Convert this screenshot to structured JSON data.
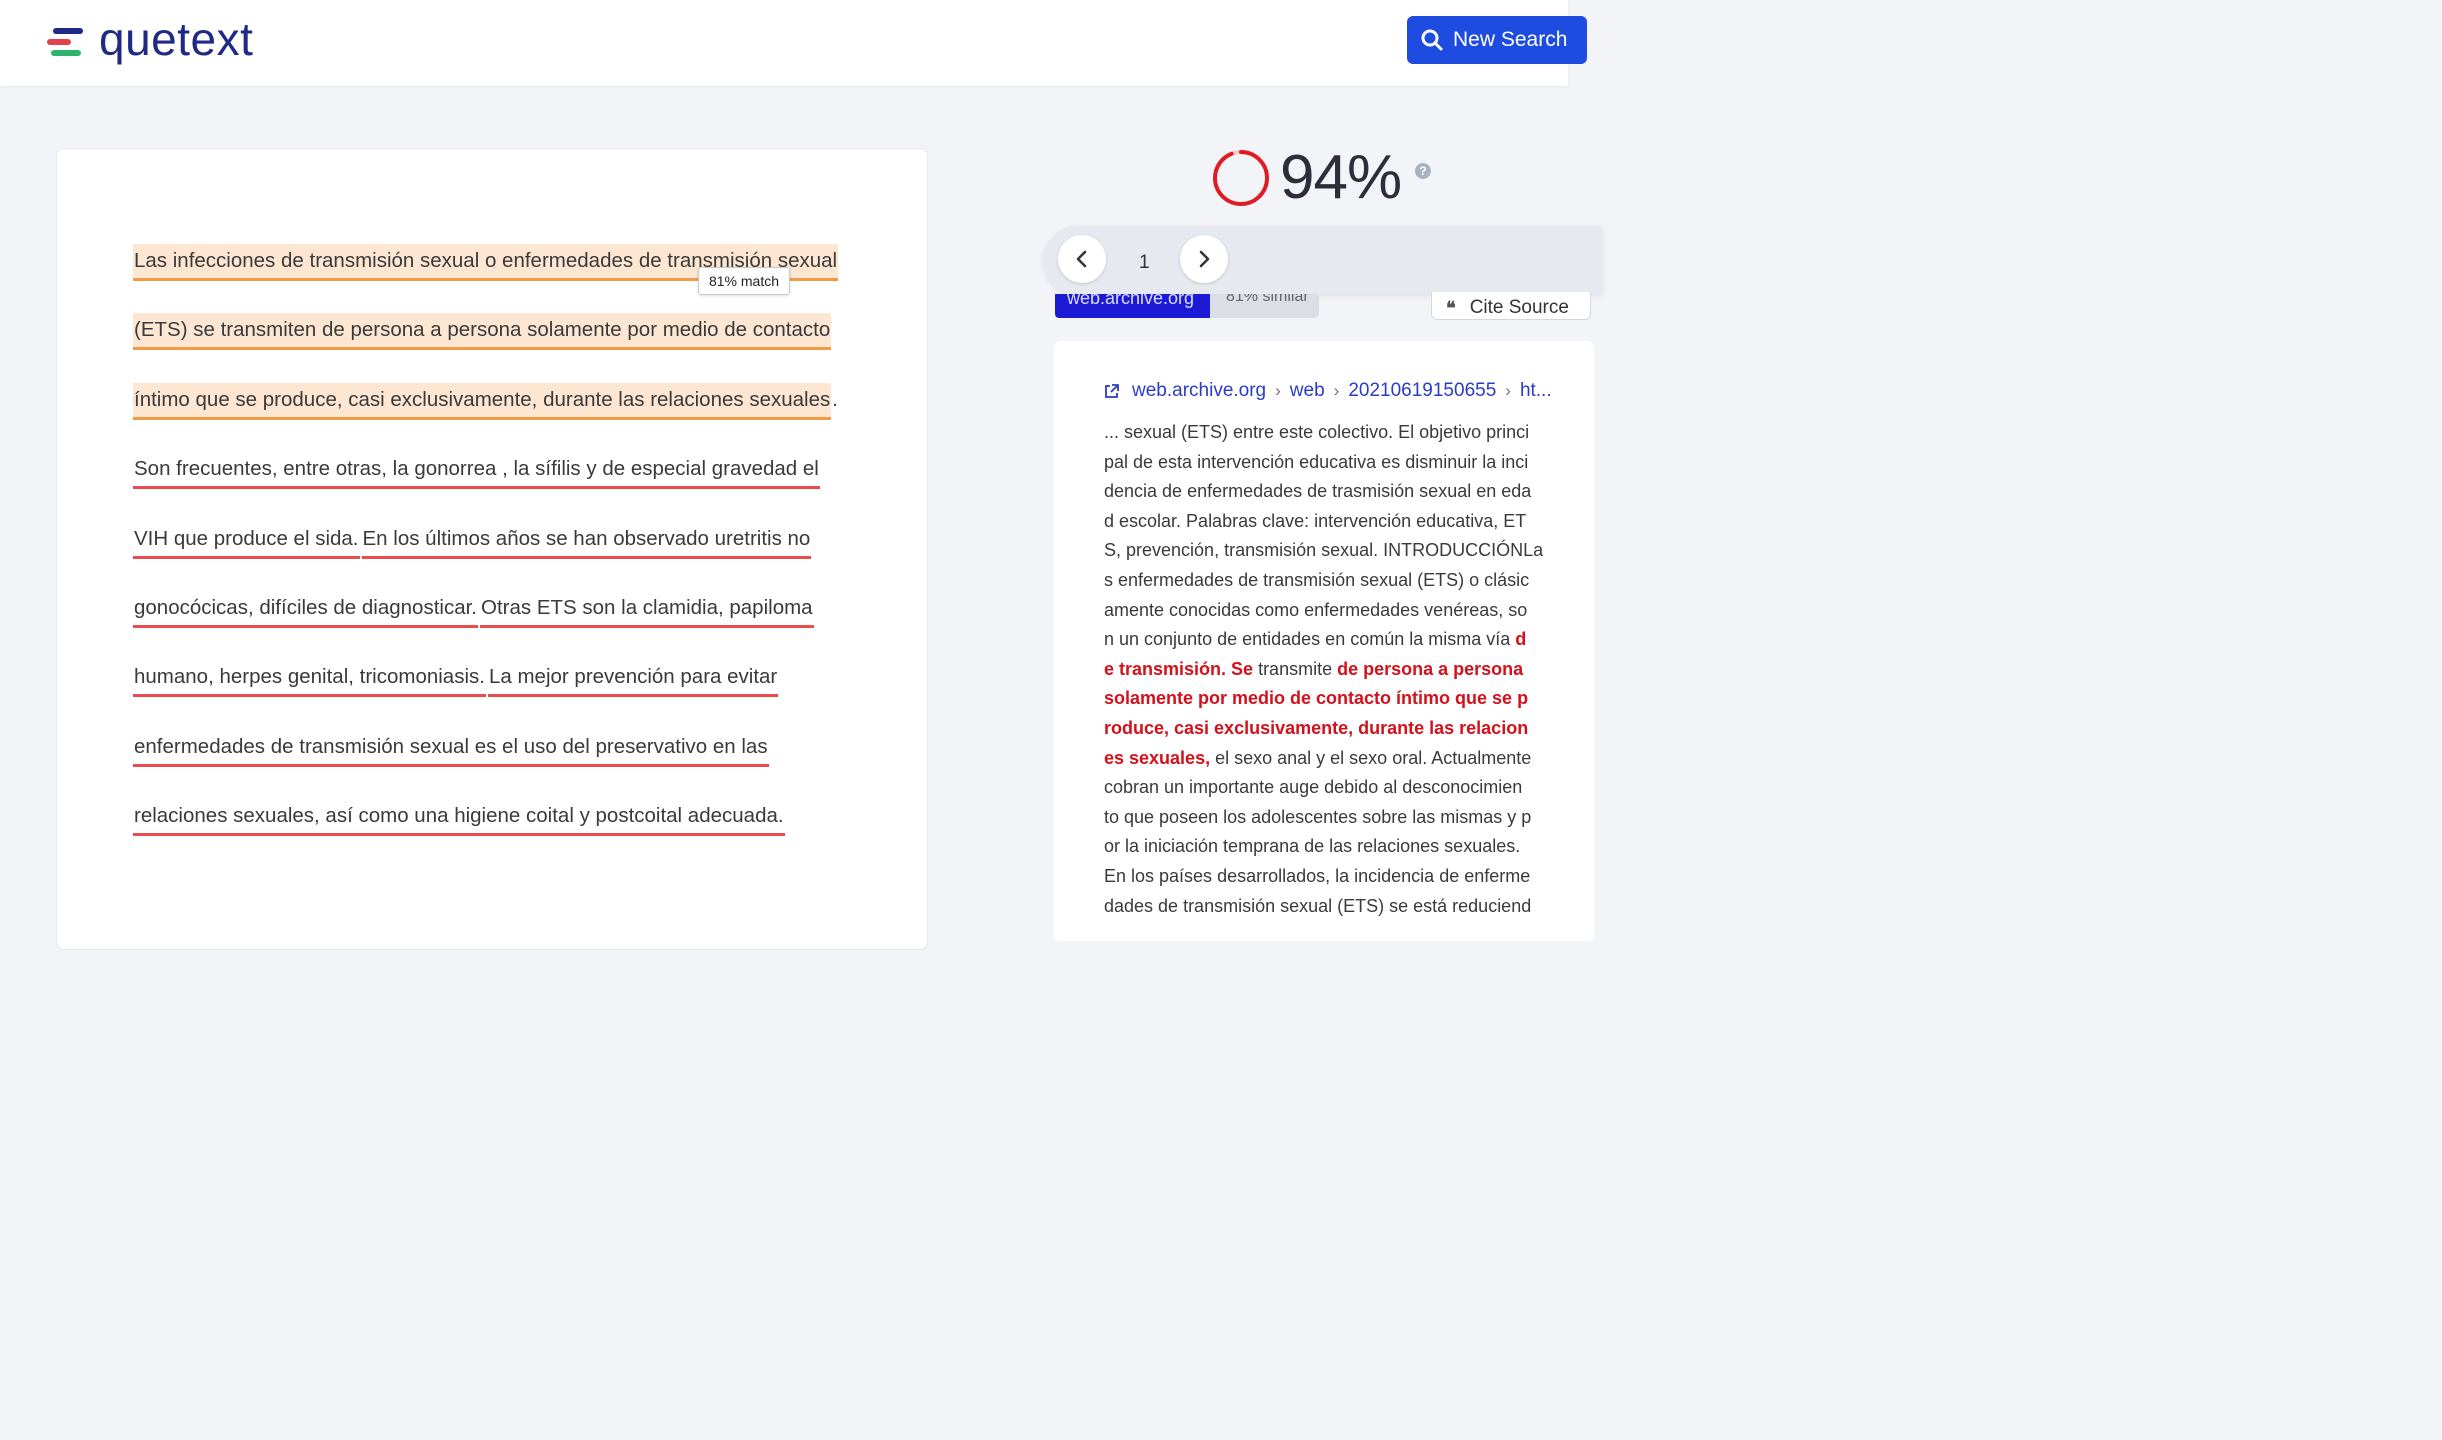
{
  "header": {
    "logo_text": "quetext",
    "new_search_label": "New Search"
  },
  "colors": {
    "brand": "#1f2a86",
    "primary_button": "#1e4ce0",
    "match_highlight": "#fde7d2",
    "match_underline": "#f39a46",
    "partial_underline": "#ea4b4b",
    "match_text": "#d4111b",
    "score_ring": "#e01b24"
  },
  "document": {
    "tooltip": "81% match",
    "lines": [
      {
        "segments": [
          {
            "text": "Las infecciones de transmisión sexual o enfermedades de transmisión sexual",
            "style": "hl"
          }
        ]
      },
      {
        "segments": [
          {
            "text": "(ETS) se transmiten de persona a persona solamente por medio de contacto",
            "style": "hl"
          }
        ]
      },
      {
        "segments": [
          {
            "text": "íntimo que se produce, casi exclusivamente, durante las relaciones sexuales",
            "style": "hl"
          },
          {
            "text": ".",
            "style": "plain"
          }
        ]
      },
      {
        "segments": [
          {
            "text": "Son frecuentes, entre otras, la gonorrea , la sífilis y de especial gravedad el",
            "style": "ul"
          }
        ]
      },
      {
        "segments": [
          {
            "text": "VIH que produce el sida.",
            "style": "ul"
          },
          {
            "text": " ",
            "style": "plain"
          },
          {
            "text": "En los últimos años se han observado uretritis no",
            "style": "ul"
          }
        ]
      },
      {
        "segments": [
          {
            "text": "gonocócicas, difíciles de diagnosticar.",
            "style": "ul"
          },
          {
            "text": " ",
            "style": "plain"
          },
          {
            "text": "Otras ETS son la clamidia, papiloma",
            "style": "ul"
          }
        ]
      },
      {
        "segments": [
          {
            "text": "humano, herpes genital, tricomoniasis.",
            "style": "ul"
          },
          {
            "text": " ",
            "style": "plain"
          },
          {
            "text": "La mejor prevención para evitar",
            "style": "ul"
          }
        ]
      },
      {
        "segments": [
          {
            "text": "enfermedades de transmisión sexual es el uso del preservativo en las",
            "style": "ul"
          }
        ]
      },
      {
        "segments": [
          {
            "text": "relaciones sexuales, así como una higiene coital y postcoital adecuada.",
            "style": "ul"
          }
        ]
      }
    ]
  },
  "score": {
    "value": "94%",
    "fraction": 0.94,
    "help_icon": "question-circle-icon"
  },
  "pager": {
    "current": "1",
    "prev_icon": "chevron-left-icon",
    "next_icon": "chevron-right-icon"
  },
  "source": {
    "site_tag": "web.archive.org",
    "similarity": "81% similar",
    "cite_label": "Cite Source",
    "breadcrumb": [
      "web.archive.org",
      "web",
      "20210619150655",
      "ht..."
    ],
    "lines": [
      [
        {
          "t": "... sexual (ETS) entre este colectivo. El objetivo princi",
          "m": false
        }
      ],
      [
        {
          "t": "pal de esta intervención educativa es disminuir la inci",
          "m": false
        }
      ],
      [
        {
          "t": "dencia de enfermedades de trasmisión sexual en eda",
          "m": false
        }
      ],
      [
        {
          "t": "d escolar. Palabras clave: intervención educativa, ET",
          "m": false
        }
      ],
      [
        {
          "t": "S, prevención, transmisión sexual. INTRODUCCIÓNLa",
          "m": false
        }
      ],
      [
        {
          "t": "s enfermedades de transmisión sexual (ETS) o clásic",
          "m": false
        }
      ],
      [
        {
          "t": "amente conocidas como enfermedades venéreas, so",
          "m": false
        }
      ],
      [
        {
          "t": "n un conjunto de entidades en común la misma vía ",
          "m": false
        },
        {
          "t": "d",
          "m": true
        }
      ],
      [
        {
          "t": "e transmisión. Se",
          "m": true
        },
        {
          "t": " transmite ",
          "m": false
        },
        {
          "t": "de persona a persona",
          "m": true
        }
      ],
      [
        {
          "t": "solamente por medio de contacto íntimo que se p",
          "m": true
        }
      ],
      [
        {
          "t": "roduce, casi exclusivamente, durante las relacion",
          "m": true
        }
      ],
      [
        {
          "t": "es sexuales,",
          "m": true
        },
        {
          "t": " el sexo anal y el sexo oral. Actualmente",
          "m": false
        }
      ],
      [
        {
          "t": "cobran un importante auge debido al desconocimien",
          "m": false
        }
      ],
      [
        {
          "t": "to que poseen los adolescentes sobre las mismas y p",
          "m": false
        }
      ],
      [
        {
          "t": "or la iniciación temprana de las relaciones sexuales.",
          "m": false
        }
      ],
      [
        {
          "t": "En los países desarrollados, la incidencia de enferme",
          "m": false
        }
      ],
      [
        {
          "t": "dades de transmisión sexual (ETS) se está reduciend",
          "m": false
        }
      ]
    ]
  }
}
